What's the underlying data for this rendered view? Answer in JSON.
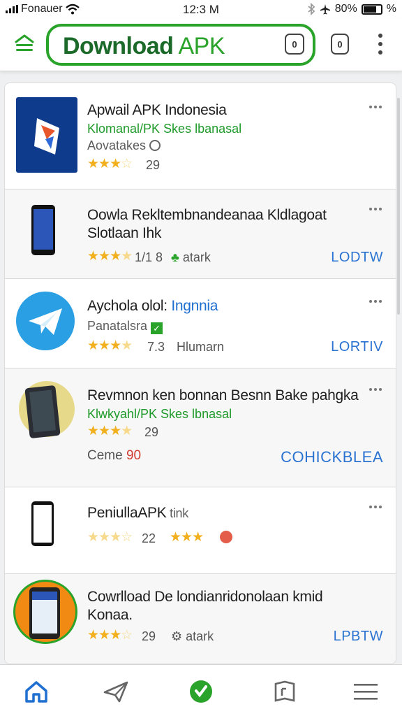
{
  "status_bar": {
    "carrier": "Fonauer",
    "time": "12:3 M",
    "battery": "80%",
    "extra": "%"
  },
  "toolbar": {
    "title_bold": "Download",
    "title_light": " APK",
    "icon1_glyph": "0",
    "icon2_glyph": "0"
  },
  "apps": [
    {
      "name": "Apwail APK Indonesia",
      "subtitle": "Klomanal/PK Skes lbanasal",
      "developer": "Aovatakes",
      "rating_count": "29"
    },
    {
      "name_line1": "Oowla Rekltembnandeanaa Kldlagoat",
      "name_line2": "Slotlaan Ihk",
      "rating_count": "1/1 8",
      "tag": "atark",
      "action": "LODTW"
    },
    {
      "name_prefix": "Aychola olol: ",
      "name_suffix": "Ingnnia",
      "subtitle": "Panatalsra",
      "rating_count": "7.3",
      "tag": "Hlumarn",
      "action": "LORTIV"
    },
    {
      "name": "Revmnon ken bonnan Besnn Bake pahgka",
      "subtitle": "Klwkyahl/PK Skes lbnasal",
      "rating_count": "29",
      "meta_label": "Ceme",
      "meta_value": "90",
      "action": "COHICKBLEA"
    },
    {
      "name_main": "PeniullaAPK",
      "name_tail": " tink",
      "rating_count": "22"
    },
    {
      "name_line1": "Cowrlload De londianridonolaan kmid",
      "name_line2": "Konaa.",
      "rating_count": "29",
      "tag": "atark",
      "action": "LPBTW"
    }
  ],
  "colors": {
    "brand_green": "#2aa32a",
    "link_blue": "#2b73d1",
    "star": "#f2b01e"
  }
}
